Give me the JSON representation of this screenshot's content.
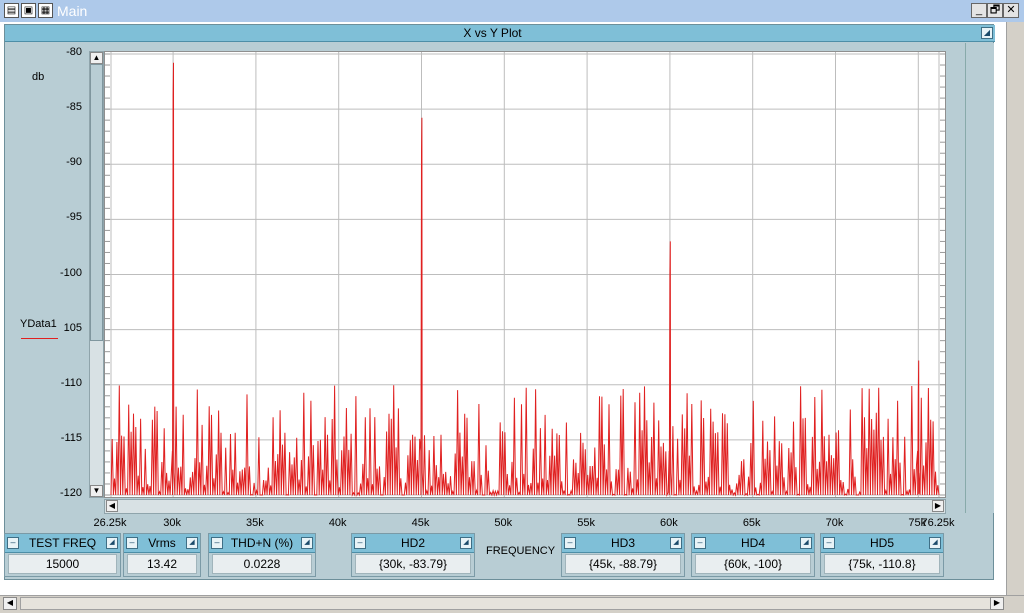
{
  "window": {
    "title": "Main",
    "min_label": "_",
    "restore_label": "🗗",
    "close_label": "✕"
  },
  "plot": {
    "title": "X vs Y Plot",
    "xlabel": "FREQUENCY",
    "ylabel": "db",
    "series_name": "YData1"
  },
  "controls": [
    {
      "name": "TEST FREQ",
      "value": "15000"
    },
    {
      "name": "Vrms",
      "value": "13.42"
    },
    {
      "name": "THD+N (%)",
      "value": "0.0228"
    },
    {
      "name": "HD2",
      "value": "{30k, -83.79}"
    },
    {
      "name": "HD3",
      "value": "{45k, -88.79}"
    },
    {
      "name": "HD4",
      "value": "{60k, -100}"
    },
    {
      "name": "HD5",
      "value": "{75k, -110.8}"
    }
  ],
  "chart_data": {
    "type": "line",
    "title": "X vs Y Plot",
    "xlabel": "FREQUENCY",
    "ylabel": "db",
    "xlim": [
      26250,
      76250
    ],
    "ylim": [
      -120,
      -80
    ],
    "x_tick_labels": [
      "26.25k",
      "30k",
      "35k",
      "40k",
      "45k",
      "50k",
      "55k",
      "60k",
      "65k",
      "70k",
      "75k",
      "76.25k"
    ],
    "x_tick_values": [
      26250,
      30000,
      35000,
      40000,
      45000,
      50000,
      55000,
      60000,
      65000,
      70000,
      75000,
      76250
    ],
    "y_tick_labels": [
      "-80",
      "-85",
      "-90",
      "-95",
      "-100",
      "105",
      "-110",
      "-115",
      "-120"
    ],
    "y_tick_values": [
      -80,
      -85,
      -90,
      -95,
      -100,
      -105,
      -110,
      -115,
      -120
    ],
    "grid": true,
    "series": [
      {
        "name": "YData1",
        "color": "#e02020",
        "noise_floor_db": -120,
        "noise_peak_range_db": [
          -120,
          -110
        ],
        "peaks": [
          {
            "x": 30000,
            "y": -83.79
          },
          {
            "x": 45000,
            "y": -88.79
          },
          {
            "x": 60000,
            "y": -100
          },
          {
            "x": 75000,
            "y": -110.8
          }
        ]
      }
    ]
  }
}
